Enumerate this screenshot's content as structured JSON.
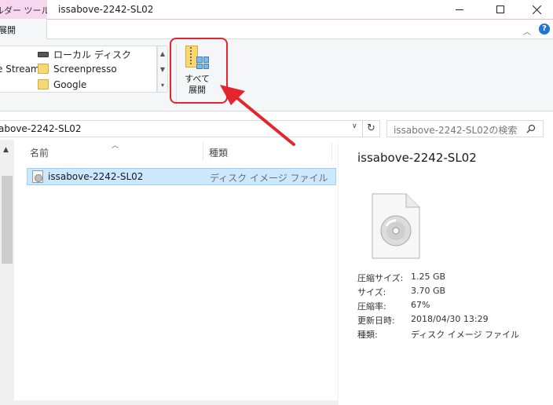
{
  "window": {
    "context_tab": "ルダー ツール",
    "title": "issabove-2242-SL02",
    "minimize": "最小化",
    "maximize": "最大化",
    "close": "閉じる"
  },
  "ribbon": {
    "active_tab": "展開",
    "gallery_items": [
      "e Stream",
      "ローカル ディスク",
      "Screenpresso",
      "Google"
    ],
    "extract_all_line1": "すべて",
    "extract_all_line2": "展開",
    "highlight_color": "#e3262d"
  },
  "address": {
    "path": "above-2242-SL02",
    "search_placeholder": "issabove-2242-SL02の検索"
  },
  "filelist": {
    "columns": [
      "名前",
      "種類"
    ],
    "rows": [
      {
        "name": "issabove-2242-SL02",
        "type": "ディスク イメージ ファイル",
        "selected": true
      }
    ]
  },
  "details": {
    "title": "issabove-2242-SL02",
    "rows": [
      {
        "key": "圧縮サイズ:",
        "value": "1.25 GB"
      },
      {
        "key": "サイズ:",
        "value": "3.70 GB"
      },
      {
        "key": "圧縮率:",
        "value": "67%"
      },
      {
        "key": "更新日時:",
        "value": "2018/04/30 13:29"
      },
      {
        "key": "種類:",
        "value": "ディスク イメージ ファイル"
      }
    ]
  },
  "colors": {
    "selection": "#cce8ff",
    "accent": "#1e76d2",
    "context_tab": "#f7d7ef"
  }
}
